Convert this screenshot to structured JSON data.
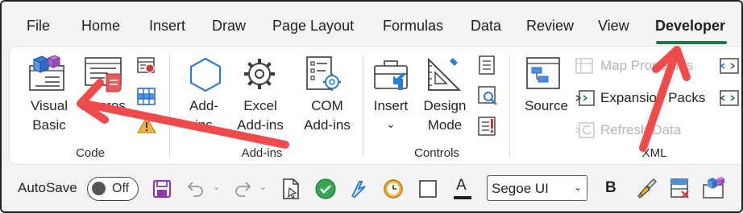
{
  "tabs": [
    "File",
    "Home",
    "Insert",
    "Draw",
    "Page Layout",
    "Formulas",
    "Data",
    "Review",
    "View",
    "Developer"
  ],
  "active_tab": "Developer",
  "groups": {
    "code": {
      "label": "Code",
      "visual_basic_line1": "Visual",
      "visual_basic_line2": "Basic",
      "macros": "Macros"
    },
    "addins": {
      "label": "Add-ins",
      "addins_line1": "Add-",
      "addins_line2": "ins",
      "excel_line1": "Excel",
      "excel_line2": "Add-ins",
      "com_line1": "COM",
      "com_line2": "Add-ins"
    },
    "controls": {
      "label": "Controls",
      "insert": "Insert",
      "insert_chevron": "⌄",
      "design_line1": "Design",
      "design_line2": "Mode"
    },
    "xml": {
      "label": "XML",
      "source": "Source",
      "map_properties": "Map Properties",
      "expansion_packs": "Expansion Packs",
      "refresh_data": "Refresh Data"
    }
  },
  "qat": {
    "autosave_label": "AutoSave",
    "toggle_state": "Off",
    "font_name": "Segoe UI",
    "bold_label": "B",
    "font_color_letter": "A",
    "undo_chevron": "⌄",
    "redo_chevron": "⌄",
    "font_dropdown_chevron": "⌄"
  },
  "colors": {
    "active_tab_underline": "#1e7a43",
    "annotation_arrow": "#ef4b4b",
    "save_icon": "#8b3aa8"
  }
}
